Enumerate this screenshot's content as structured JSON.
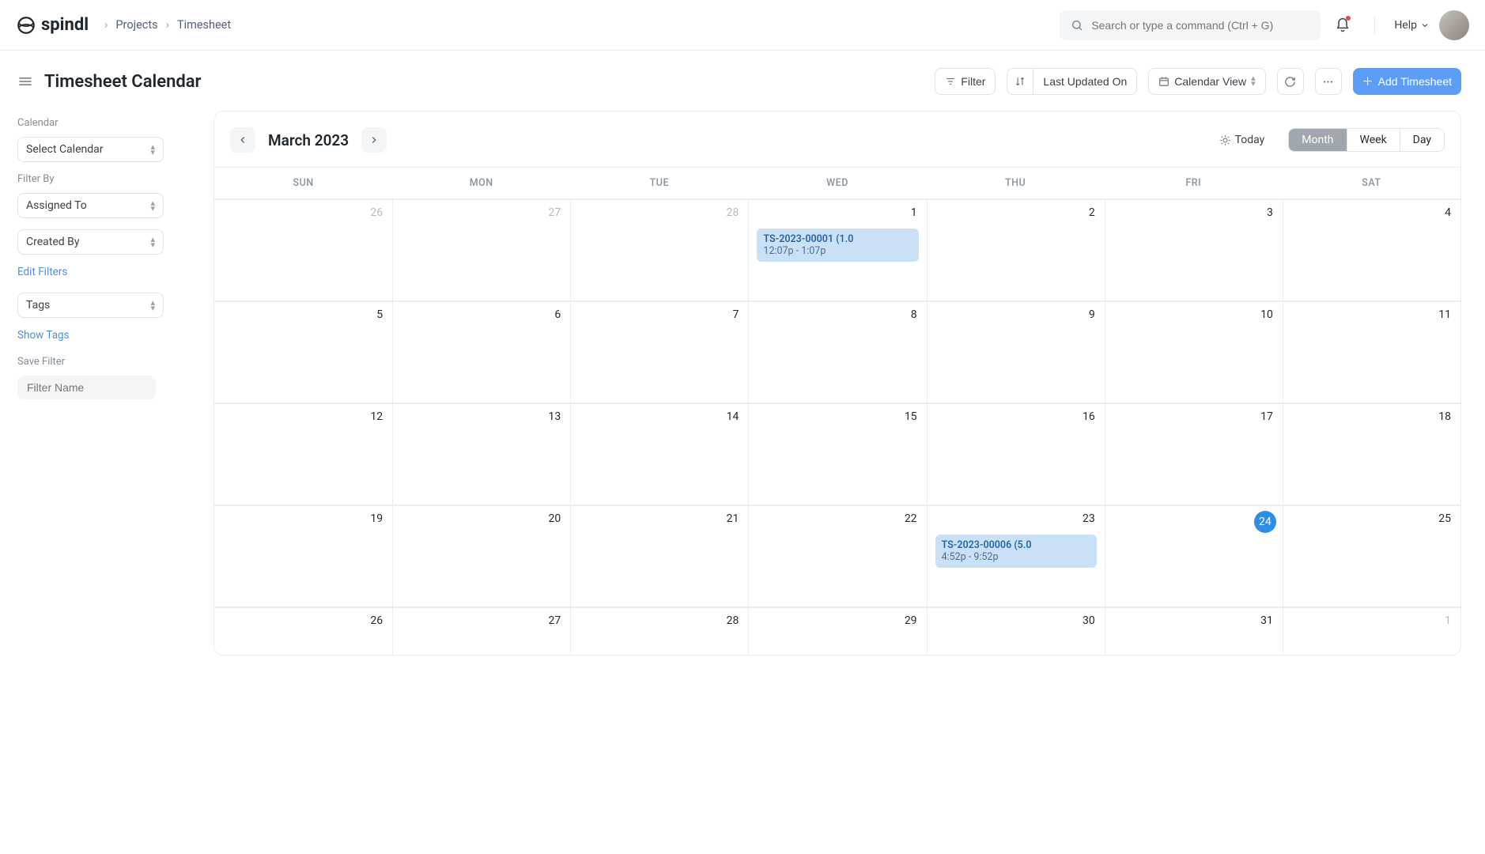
{
  "brand": "spindl",
  "breadcrumb": [
    "Projects",
    "Timesheet"
  ],
  "search": {
    "placeholder": "Search or type a command (Ctrl + G)"
  },
  "help_label": "Help",
  "page_title": "Timesheet Calendar",
  "toolbar": {
    "filter_label": "Filter",
    "sort_label": "Last Updated On",
    "view_label": "Calendar View",
    "add_label": "Add Timesheet"
  },
  "sidebar": {
    "calendar_heading": "Calendar",
    "select_calendar": "Select Calendar",
    "filter_by_heading": "Filter By",
    "assigned_to": "Assigned To",
    "created_by": "Created By",
    "edit_filters": "Edit Filters",
    "tags": "Tags",
    "show_tags": "Show Tags",
    "save_filter_heading": "Save Filter",
    "filter_name_placeholder": "Filter Name"
  },
  "calendar": {
    "month_label": "March 2023",
    "today_label": "Today",
    "tabs": {
      "month": "Month",
      "week": "Week",
      "day": "Day"
    },
    "day_headers": [
      "SUN",
      "MON",
      "TUE",
      "WED",
      "THU",
      "FRI",
      "SAT"
    ],
    "weeks": [
      [
        {
          "n": "26",
          "muted": true
        },
        {
          "n": "27",
          "muted": true
        },
        {
          "n": "28",
          "muted": true
        },
        {
          "n": "1",
          "events": [
            {
              "title": "TS-2023-00001 (1.0",
              "time": "12:07p - 1:07p"
            }
          ]
        },
        {
          "n": "2"
        },
        {
          "n": "3"
        },
        {
          "n": "4"
        }
      ],
      [
        {
          "n": "5"
        },
        {
          "n": "6"
        },
        {
          "n": "7"
        },
        {
          "n": "8"
        },
        {
          "n": "9"
        },
        {
          "n": "10"
        },
        {
          "n": "11"
        }
      ],
      [
        {
          "n": "12"
        },
        {
          "n": "13"
        },
        {
          "n": "14"
        },
        {
          "n": "15"
        },
        {
          "n": "16"
        },
        {
          "n": "17"
        },
        {
          "n": "18"
        }
      ],
      [
        {
          "n": "19"
        },
        {
          "n": "20"
        },
        {
          "n": "21"
        },
        {
          "n": "22"
        },
        {
          "n": "23",
          "events": [
            {
              "title": "TS-2023-00006 (5.0",
              "time": "4:52p - 9:52p"
            }
          ]
        },
        {
          "n": "24",
          "today": true
        },
        {
          "n": "25"
        }
      ],
      [
        {
          "n": "26"
        },
        {
          "n": "27"
        },
        {
          "n": "28"
        },
        {
          "n": "29"
        },
        {
          "n": "30"
        },
        {
          "n": "31"
        },
        {
          "n": "1",
          "muted": true
        }
      ]
    ]
  }
}
